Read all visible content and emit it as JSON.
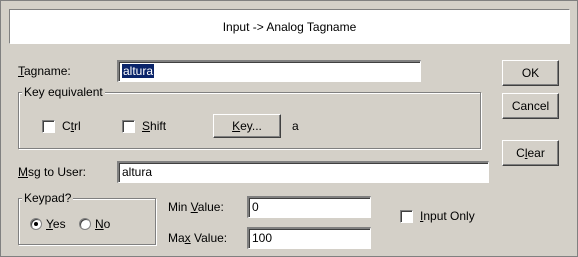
{
  "dialog": {
    "title": "Input -> Analog Tagname"
  },
  "tagname": {
    "label_pre": "",
    "label_key": "T",
    "label_post": "agname:",
    "value": "altura"
  },
  "key_equivalent": {
    "legend": "Key equivalent",
    "ctrl": {
      "pre": "C",
      "key": "t",
      "post": "rl",
      "checked": false
    },
    "shift": {
      "pre": "",
      "key": "S",
      "post": "hift",
      "checked": false
    },
    "key_button": {
      "pre": "",
      "key": "K",
      "post": "ey..."
    },
    "key_value": "a"
  },
  "msg_to_user": {
    "label_pre": "",
    "label_key": "M",
    "label_post": "sg to User:",
    "value": "altura"
  },
  "keypad": {
    "legend": "Keypad?",
    "yes": {
      "pre": "",
      "key": "Y",
      "post": "es",
      "selected": true
    },
    "no": {
      "pre": "",
      "key": "N",
      "post": "o",
      "selected": false
    }
  },
  "min_value": {
    "label_pre": "Min ",
    "label_key": "V",
    "label_post": "alue:",
    "value": "0"
  },
  "max_value": {
    "label_pre": "Ma",
    "label_key": "x",
    "label_post": " Value:",
    "value": "100"
  },
  "input_only": {
    "pre": "",
    "key": "I",
    "post": "nput Only",
    "checked": false
  },
  "buttons": {
    "ok": "OK",
    "cancel": "Cancel",
    "clear_pre": "C",
    "clear_key": "l",
    "clear_post": "ear"
  }
}
